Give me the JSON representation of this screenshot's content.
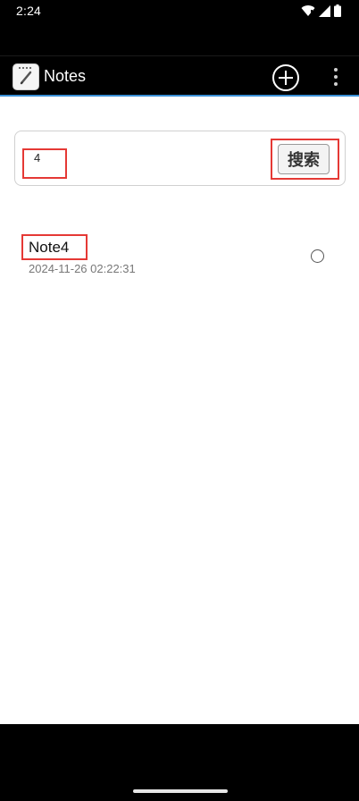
{
  "status_bar": {
    "time": "2:24"
  },
  "app_bar": {
    "title": "Notes",
    "add_icon": "plus-circle-icon",
    "menu_icon": "more-vert-icon",
    "app_icon": "notepad-pencil-icon"
  },
  "search": {
    "value": "4",
    "button_label": "搜索"
  },
  "notes": [
    {
      "title": "Note4",
      "timestamp": "2024-11-26 02:22:31",
      "selected": false
    }
  ],
  "colors": {
    "accent": "#3a8fd6",
    "highlight": "#e53935"
  }
}
